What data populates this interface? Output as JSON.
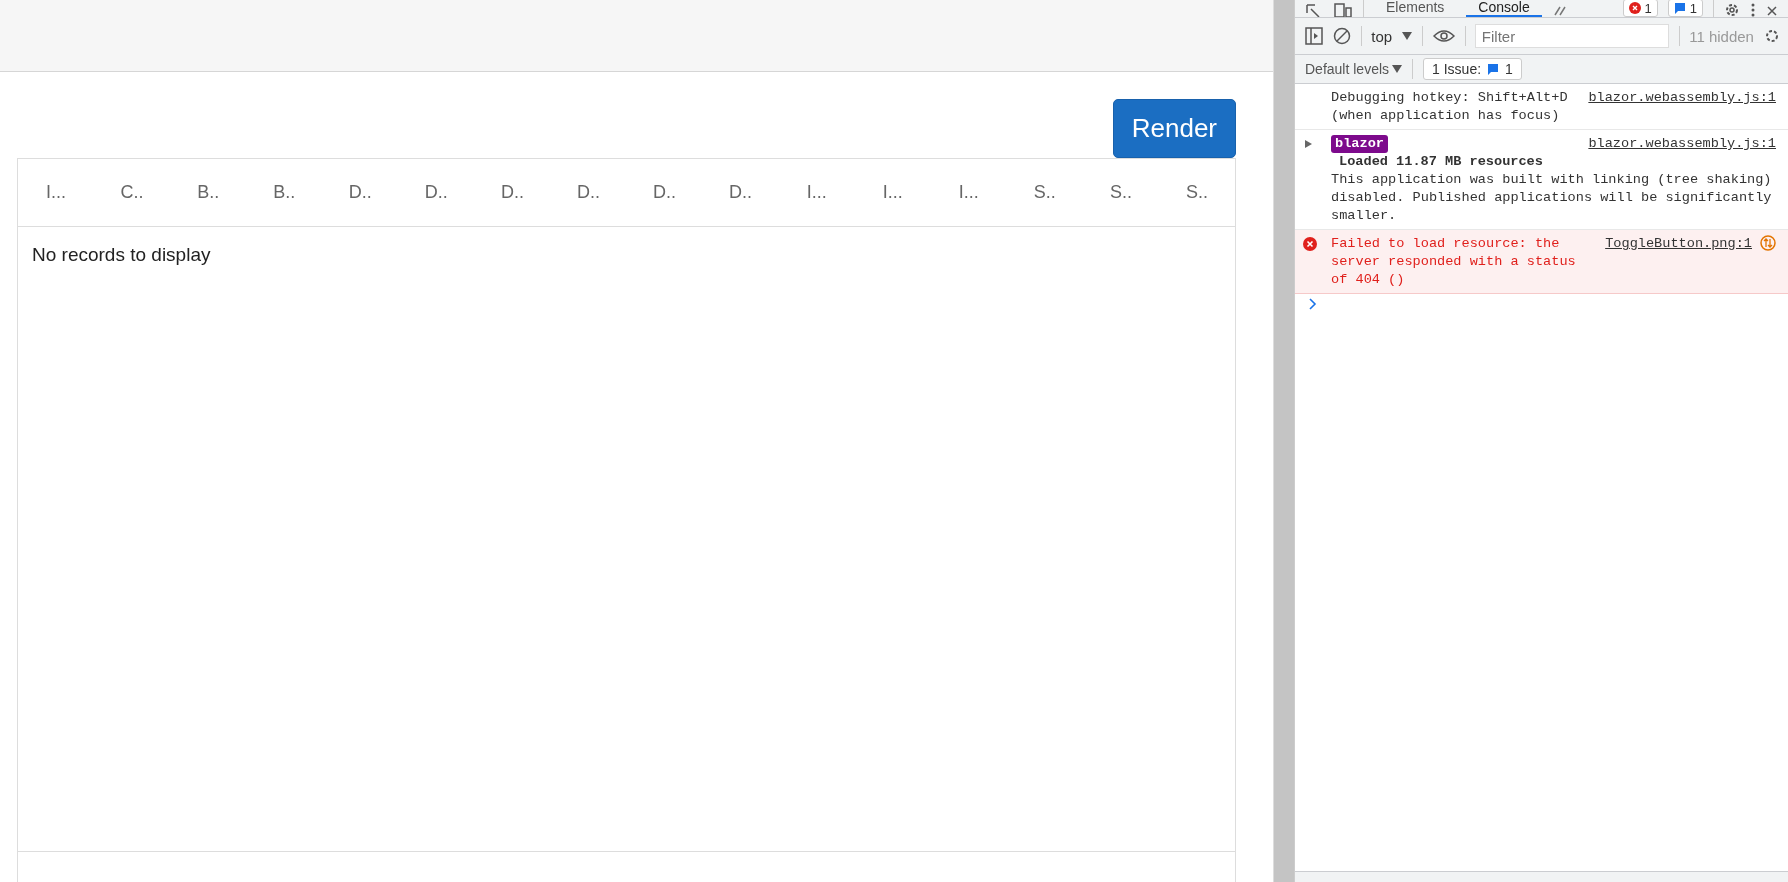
{
  "page": {
    "render_button": "Render",
    "grid": {
      "columns": [
        "I...",
        "C..",
        "B..",
        "B..",
        "D..",
        "D..",
        "D..",
        "D..",
        "D..",
        "D..",
        "I...",
        "I...",
        "I...",
        "S..",
        "S..",
        "S.."
      ],
      "empty_text": "No records to display"
    }
  },
  "devtools": {
    "tabs": [
      {
        "label": "Elements",
        "selected": false
      },
      {
        "label": "Console",
        "selected": true
      }
    ],
    "error_count": "1",
    "message_count": "1",
    "context": "top",
    "filter": {
      "placeholder": "Filter"
    },
    "hidden_count": "11 hidden",
    "levels": "Default levels",
    "issues": {
      "label": "1 Issue:",
      "count": "1"
    },
    "messages": [
      {
        "kind": "log",
        "text": "Debugging hotkey: Shift+Alt+D (when application has focus)",
        "source": "blazor.webassembly.js:1"
      },
      {
        "kind": "group",
        "expanded": false,
        "badge": "blazor",
        "title": "Loaded 11.87 MB resources",
        "text": "This application was built with linking (tree shaking) disabled. Published applications will be significantly smaller.",
        "source": "blazor.webassembly.js:1"
      },
      {
        "kind": "error",
        "text": "Failed to load resource: the server responded with a status of 404 ()",
        "source": "ToggleButton.png:1"
      }
    ]
  }
}
